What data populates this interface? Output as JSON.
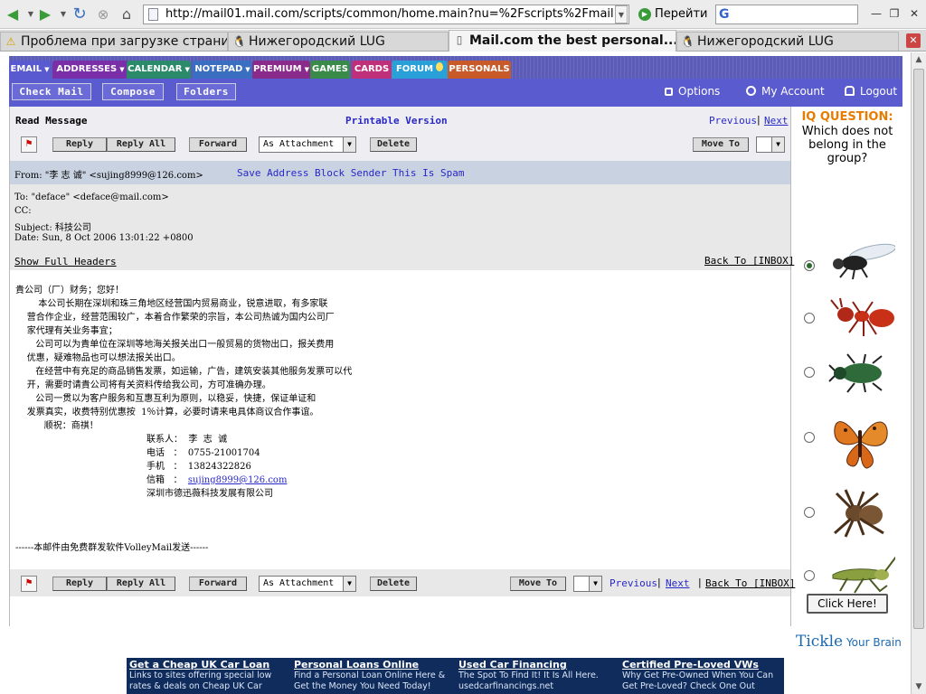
{
  "browser": {
    "url": "http://mail01.mail.com/scripts/common/home.main?nu=%2Fscripts%2Fmail",
    "go_label": "Перейти",
    "tabs": [
      {
        "label": "Проблема при загрузке страни..."
      },
      {
        "label": "Нижегородский LUG"
      },
      {
        "label": "Mail.com the best personal..."
      },
      {
        "label": "Нижегородский LUG"
      }
    ]
  },
  "app": {
    "tabs": [
      {
        "label": "EMAIL",
        "color": "#5a5ad0",
        "arrow": "▼"
      },
      {
        "label": "ADDRESSES",
        "color": "#7a2ea8",
        "arrow": "▼"
      },
      {
        "label": "CALENDAR",
        "color": "#2a8a6a",
        "arrow": "▼"
      },
      {
        "label": "NOTEPAD",
        "color": "#3a6ec0",
        "arrow": "▼"
      },
      {
        "label": "PREMIUM",
        "color": "#8a2a8a",
        "arrow": "▼"
      },
      {
        "label": "GAMES",
        "color": "#3a8a4a",
        "arrow": ""
      },
      {
        "label": "CARDS",
        "color": "#c0307a",
        "arrow": ""
      },
      {
        "label": "FORUM",
        "color": "#2aa0d8",
        "arrow": ""
      },
      {
        "label": "PERSONALS",
        "color": "#c85a2a",
        "arrow": ""
      }
    ],
    "toolbar": {
      "check_mail": "Check Mail",
      "compose": "Compose",
      "folders": "Folders",
      "options": "Options",
      "my_account": "My Account",
      "logout": "Logout"
    }
  },
  "message": {
    "heading": "Read Message",
    "printable": "Printable Version",
    "previous": "Previous",
    "next": "Next",
    "reply": "Reply",
    "reply_all": "Reply All",
    "forward": "Forward",
    "forward_mode": "As Attachment",
    "delete": "Delete",
    "move_to": "Move To",
    "from_label": "From:",
    "from_name": "\"李 志 诚\" <sujing8999@126.com>",
    "save_address": "Save Address",
    "block_sender": "Block Sender",
    "this_is_spam": "This Is Spam",
    "to": "To: \"deface\" <deface@mail.com>",
    "cc": "CC:",
    "subject": "Subject: 科技公司",
    "date": "Date: Sun, 8 Oct 2006 13:01:22 +0800",
    "show_full_headers": "Show Full Headers",
    "back_to_inbox": "Back To [INBOX]",
    "body_lines": [
      "貴公司（厂）财务；您好！",
      "        本公司长期在深圳和珠三角地区经营国内贸易商业，锐意进取，有多家联",
      "    营合作企业，经营范围较广，本着合作繁荣的宗旨，本公司热诚为国内公司厂",
      "    家代理有关业务事宜；",
      "       公司可以为貴单位在深圳等地海关报关出口一般贸易的货物出口，报关费用",
      "    优惠，疑难物品也可以想法报关出口。",
      "       在经营中有充足的商品销售发票，如运输，广告，建筑安装其他服务发票可以代",
      "    开，需要时请貴公司将有关资料传给我公司，方可准确办理。",
      "       公司一贯以为客户服务和互惠互利为原则，以稳妥，快捷，保证单证和",
      "    发票真实，收费特别优惠按  1％计算，必要时请来电具体商议合作事谊。",
      "          顺祝：商祺！"
    ],
    "contact": {
      "person": "联系人：  李  志  诚",
      "phone": "电话   ：  0755-21001704",
      "mobile": "手机   ：  13824322826",
      "mail_label": "信箱   ：  ",
      "mail": "sujing8999@126.com",
      "company": "深圳市德迅薇科技发展有限公司"
    },
    "footer": "------本邮件由免费群发软件VolleyMail发送------"
  },
  "sidebar_ad": {
    "title": "IQ QUESTION:",
    "question": "Which does not belong in the group?",
    "button": "Click Here!",
    "brand": "Tickle",
    "brand_tail": "Your Brain",
    "choices": [
      "fly",
      "ant",
      "beetle",
      "butterfly",
      "spider",
      "grasshopper"
    ],
    "selected": 0
  },
  "bottom_ad": [
    {
      "title": "Get a Cheap UK Car Loan",
      "line1": "Links to sites offering special low",
      "line2": "rates & deals on Cheap UK Car"
    },
    {
      "title": "Personal Loans Online",
      "line1": "Find a Personal Loan Online Here &",
      "line2": "Get the Money You Need Today!"
    },
    {
      "title": "Used Car Financing",
      "line1": "The Spot To Find It! It Is All Here.",
      "line2": "usedcarfinancings.net"
    },
    {
      "title": "Certified Pre-Loved VWs",
      "line1": "Why Get Pre-Owned When You Can",
      "line2": "Get Pre-Loved? Check One Out"
    }
  ]
}
